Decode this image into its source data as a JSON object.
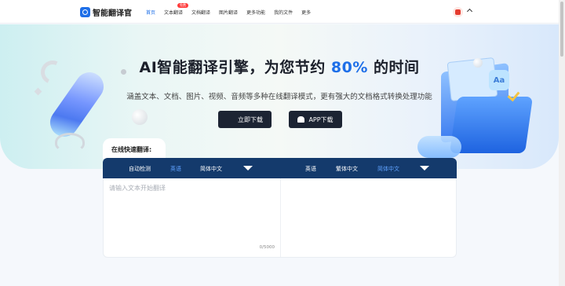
{
  "header": {
    "logo_text": "智能翻译官",
    "nav": [
      {
        "label": "首页",
        "active": true
      },
      {
        "label": "文本翻译",
        "badge": "免费"
      },
      {
        "label": "文档翻译"
      },
      {
        "label": "图片翻译"
      },
      {
        "label": "更多功能"
      },
      {
        "label": "我的文件"
      },
      {
        "label": "更多"
      }
    ]
  },
  "hero": {
    "title_prefix": "AI智能翻译引擎，为您节约 ",
    "title_accent": "80%",
    "title_suffix": " 的时间",
    "subtitle": "涵盖文本、文档、图片、视频、音频等多种在线翻译模式，更有强大的文档格式转换处理功能",
    "btn_download": "立即下载",
    "btn_app": "APP下载",
    "deco_aa": "Aa"
  },
  "quick": {
    "tab_label": "在线快速翻译:",
    "left_langs": [
      "自动检测",
      "英语",
      "简体中文"
    ],
    "right_langs": [
      "英语",
      "繁体中文",
      "简体中文"
    ],
    "placeholder": "请输入文本开始翻译",
    "counter": "0/5000"
  },
  "colors": {
    "accent": "#1e6fe8",
    "bar": "#143a6c",
    "active_lang": "#5fa2ff",
    "badge": "#ff3b3b"
  }
}
